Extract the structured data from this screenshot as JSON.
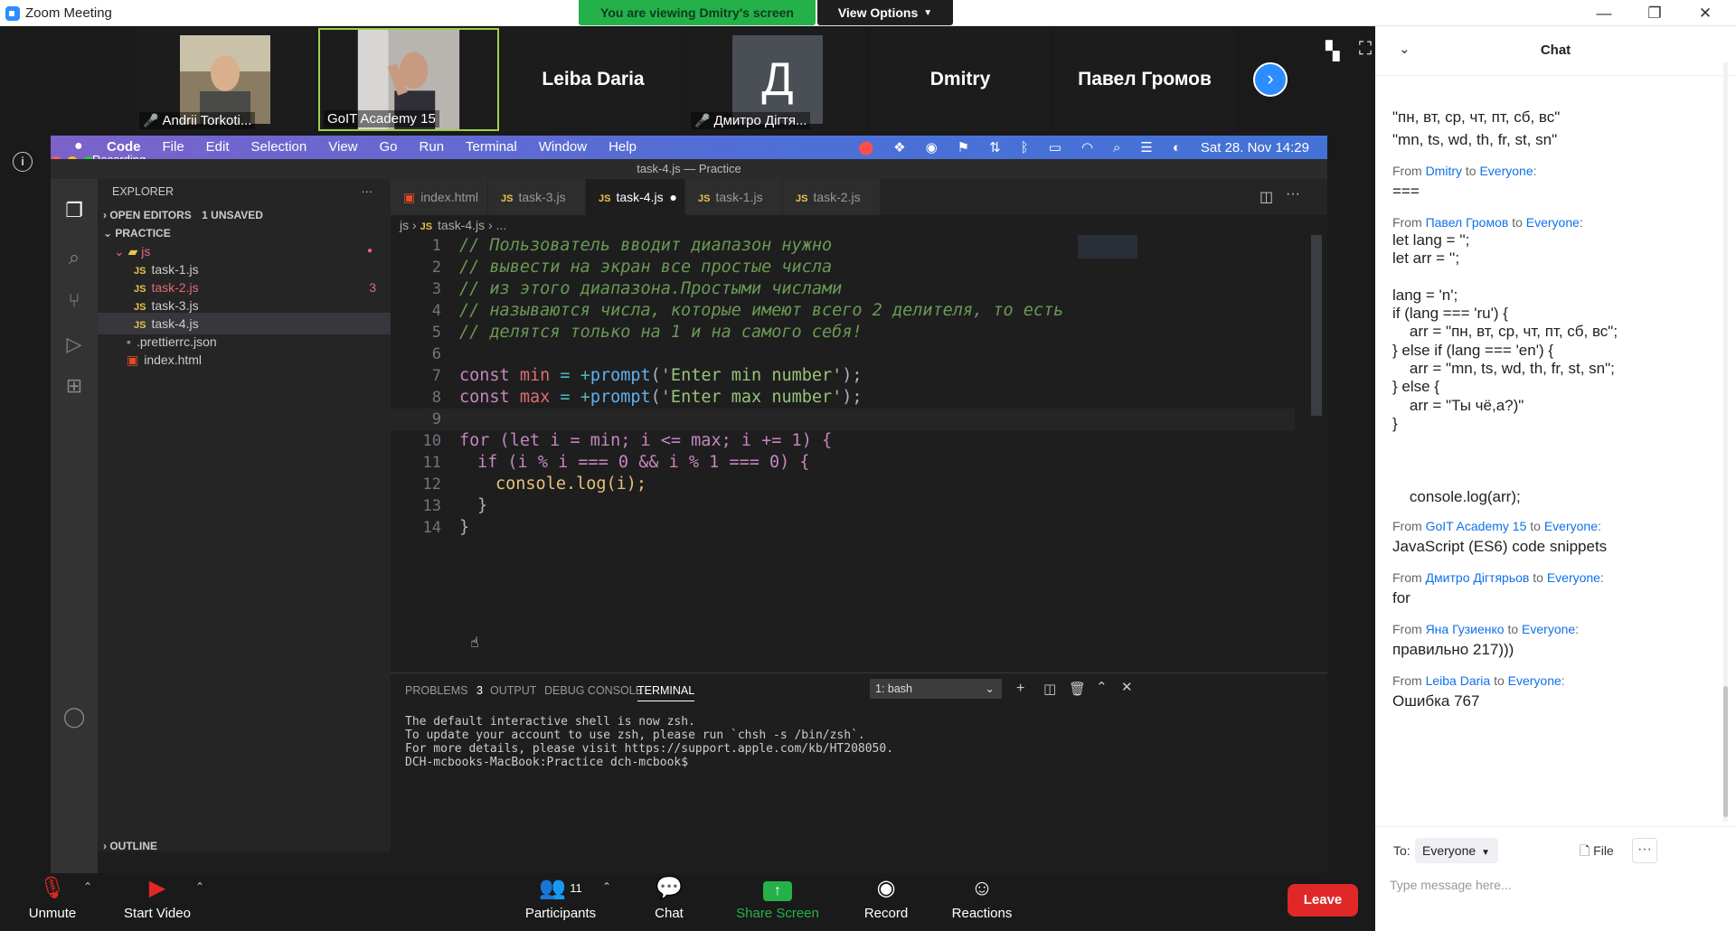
{
  "window": {
    "title": "Zoom Meeting",
    "minimize": "—",
    "restore": "❐",
    "close": "✕"
  },
  "share_bar": {
    "viewing": "You are viewing Dmitry's screen",
    "view_options": "View Options"
  },
  "participants_strip": [
    {
      "name": "Andrii Torkoti...",
      "muted": true,
      "video": true
    },
    {
      "name": "GoIT Academy 15",
      "muted": false,
      "video": true
    },
    {
      "name": "Leiba Daria",
      "muted": false,
      "video": false
    },
    {
      "name": "Дмитро Дігтя...",
      "muted": true,
      "video": false,
      "initial": "Д"
    },
    {
      "name": "Dmitry",
      "muted": false,
      "video": false
    },
    {
      "name": "Павел Громов",
      "muted": false,
      "video": false
    }
  ],
  "recording": {
    "label": "Recording"
  },
  "mac_menu": {
    "items": [
      "Code",
      "File",
      "Edit",
      "Selection",
      "View",
      "Go",
      "Run",
      "Terminal",
      "Window",
      "Help"
    ],
    "clock": "Sat 28. Nov  14:29"
  },
  "vscode": {
    "title": "task-4.js — Practice",
    "explorer": {
      "header": "EXPLORER",
      "open_editors": "OPEN EDITORS",
      "unsaved": "1 UNSAVED",
      "project": "PRACTICE",
      "folder": "js",
      "files": [
        "task-1.js",
        "task-2.js",
        "task-3.js",
        "task-4.js"
      ],
      "task2_problems": "3",
      "root_files": [
        ".prettierrc.json",
        "index.html"
      ],
      "outline": "OUTLINE"
    },
    "tabs": [
      "index.html",
      "task-3.js",
      "task-4.js",
      "task-1.js",
      "task-2.js"
    ],
    "active_tab": "task-4.js",
    "breadcrumb": {
      "folder": "js",
      "file": "task-4.js",
      "rest": "..."
    },
    "line_numbers": [
      "1",
      "2",
      "3",
      "4",
      "5",
      "6",
      "7",
      "8",
      "9",
      "10",
      "11",
      "12",
      "13",
      "14"
    ],
    "code": {
      "c1": "// Пользователь вводит диапазон нужно",
      "c2": "// вывести на экран все простые числа",
      "c3": "// из этого диапазона.Простыми числами",
      "c4": "// называются числа, которые имеют всего 2 делителя, то есть",
      "c5": "// делятся только на 1 и на самого себя!",
      "l7": {
        "kw": "const",
        "var": "min",
        "eq": " = ",
        "op": "+",
        "fn": "prompt",
        "str": "'Enter min number'"
      },
      "l8": {
        "kw": "const",
        "var": "max",
        "eq": " = ",
        "op": "+",
        "fn": "prompt",
        "str": "'Enter max number'"
      },
      "l10": "for (let i = min; i <= max; i += 1) {",
      "l11": "if (i % i === 0 && i % 1 === 0) {",
      "l12": "console.log(i);",
      "l13": "}",
      "l14": "}"
    },
    "panel": {
      "tabs": [
        "PROBLEMS",
        "OUTPUT",
        "DEBUG CONSOLE",
        "TERMINAL"
      ],
      "problems_count": "3",
      "shell": "1: bash",
      "terminal_lines": [
        "The default interactive shell is now zsh.",
        "To update your account to use zsh, please run `chsh -s /bin/zsh`.",
        "For more details, please visit https://support.apple.com/kb/HT208050.",
        "DCH-mcbooks-MacBook:Practice dch-mcbook$"
      ]
    }
  },
  "toolbar": {
    "unmute": "Unmute",
    "start_video": "Start Video",
    "participants": "Participants",
    "participants_count": "11",
    "chat": "Chat",
    "share_screen": "Share Screen",
    "record": "Record",
    "reactions": "Reactions",
    "leave": "Leave"
  },
  "chat": {
    "title": "Chat",
    "messages": [
      {
        "from": "",
        "to": "",
        "text": "\"пн, вт, ср, чт, пт, сб, вс\"\n\"mn, ts, wd, th, fr, st, sn\""
      },
      {
        "from": "Dmitry",
        "to": "Everyone",
        "text": "==="
      },
      {
        "from": "Павел Громов",
        "to": "Everyone",
        "text": "let lang = '';\nlet arr = '';\n\nlang = 'n';\nif (lang === 'ru') {\n    arr = \"пн, вт, ср, чт, пт, сб, вс\";\n} else if (lang === 'en') {\n    arr = \"mn, ts, wd, th, fr, st, sn\";\n} else {\n    arr = \"Ты чё,а?)\"\n}\n\n\n\n    console.log(arr);"
      },
      {
        "from": "GoIT Academy 15",
        "to": "Everyone",
        "text": "JavaScript (ES6) code snippets"
      },
      {
        "from": "Дмитро Дігтярьов",
        "to": "Everyone",
        "text": "for"
      },
      {
        "from": "Яна Гузиенко",
        "to": "Everyone",
        "text": "правильно 217)))"
      },
      {
        "from": "Leiba Daria",
        "to": "Everyone",
        "text": "Ошибка 767"
      }
    ],
    "from_word": "From",
    "to_word": "to",
    "to_label": "To:",
    "recipient": "Everyone",
    "file": "File",
    "placeholder": "Type message here..."
  }
}
